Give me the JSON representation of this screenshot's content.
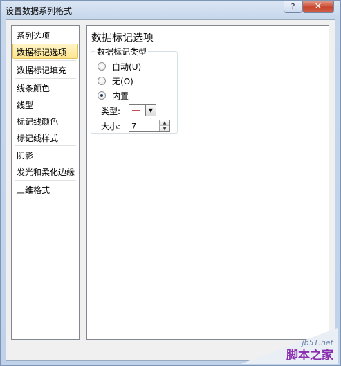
{
  "window": {
    "title": "设置数据系列格式",
    "help_label": "?",
    "close_label": "✕"
  },
  "sidebar": {
    "items": [
      {
        "label": "系列选项"
      },
      {
        "label": "数据标记选项",
        "selected": true
      },
      {
        "label": "数据标记填充"
      },
      {
        "label": "线条颜色"
      },
      {
        "label": "线型"
      },
      {
        "label": "标记线颜色"
      },
      {
        "label": "标记线样式"
      },
      {
        "label": "阴影"
      },
      {
        "label": "发光和柔化边缘"
      },
      {
        "label": "三维格式"
      }
    ]
  },
  "main": {
    "title": "数据标记选项",
    "group": {
      "legend": "数据标记类型",
      "options": [
        {
          "label": "自动",
          "accel": "(U)",
          "checked": false
        },
        {
          "label": "无",
          "accel": "(O)",
          "checked": false
        },
        {
          "label": "内置",
          "accel": "",
          "checked": true
        }
      ],
      "type_label": "类型:",
      "type_value_icon": "dash-marker-icon",
      "marker_color": "#c0504d",
      "size_label": "大小:",
      "size_value": "7"
    }
  },
  "watermark": {
    "site": "jb51.net",
    "text": "脚本之家"
  },
  "colors": {
    "selected_bg": "#fde58f",
    "close_button": "#c7452c"
  }
}
